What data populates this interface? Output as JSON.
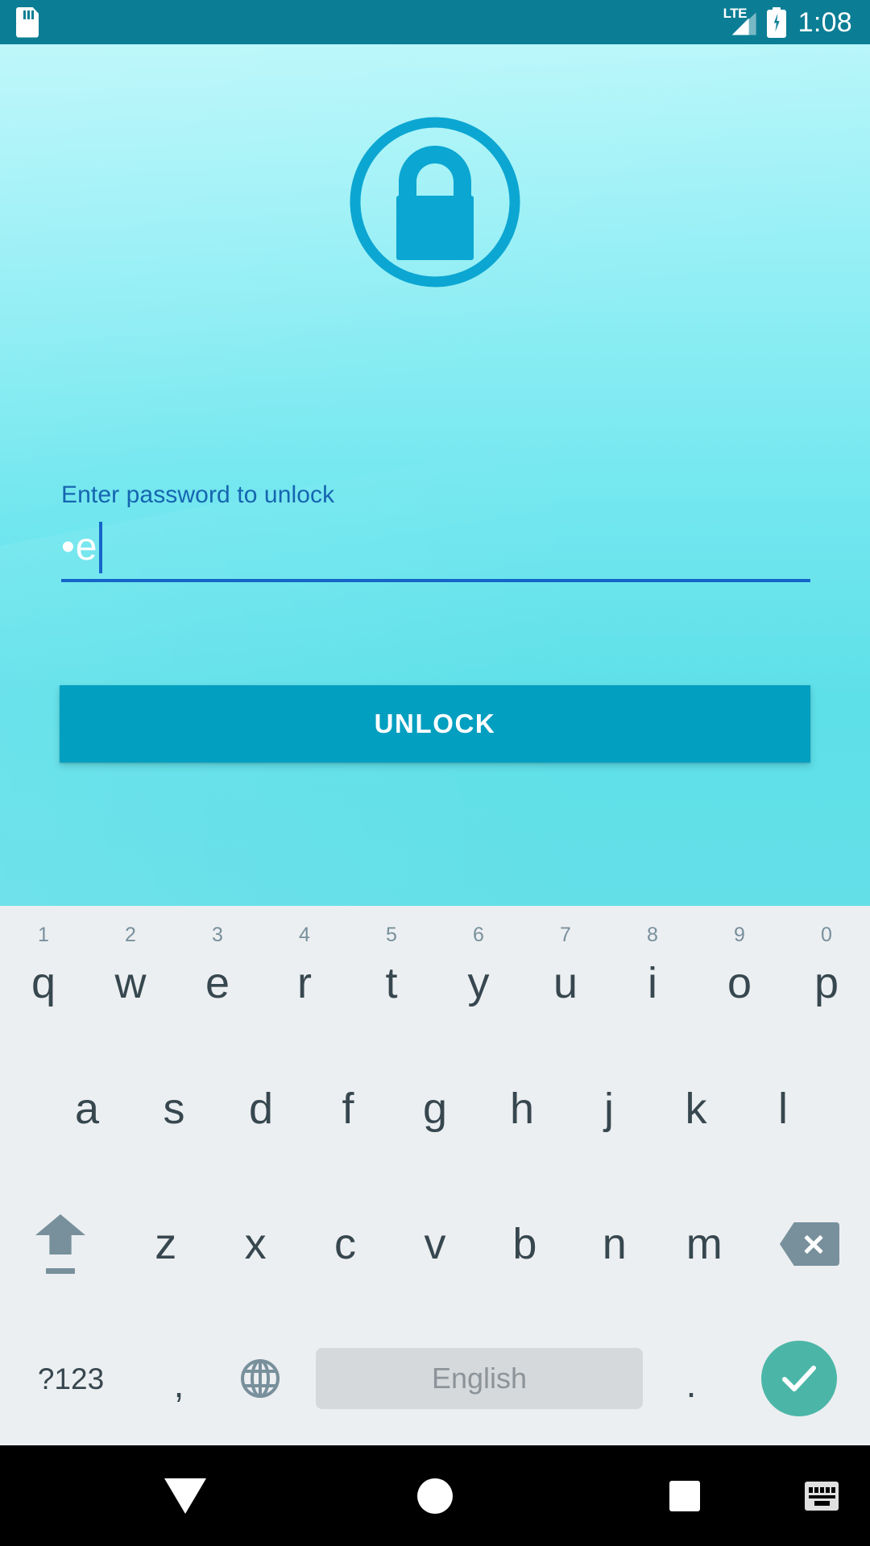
{
  "status_bar": {
    "sd_card_icon": "sd-card-icon",
    "network_label": "LTE",
    "signal_icon": "signal-bars-icon",
    "battery_icon": "battery-charging-icon",
    "time": "1:08",
    "background_color": "#0b7e95"
  },
  "lock_screen": {
    "lock_icon": "lock-circle-icon",
    "accent_color": "#039fc0",
    "label": "Enter password to unlock",
    "label_color": "#1565b0",
    "password_value": "•e",
    "password_placeholder": "",
    "underline_color": "#1565c9",
    "unlock_label": "UNLOCK",
    "wallpaper_top_color": "#b4f6fa",
    "wallpaper_bottom_color": "#63dfe8"
  },
  "keyboard": {
    "background_color": "#eceff1",
    "key_text_color": "#37474f",
    "number_hint_color": "#78909c",
    "row1": [
      {
        "letter": "q",
        "number": "1"
      },
      {
        "letter": "w",
        "number": "2"
      },
      {
        "letter": "e",
        "number": "3"
      },
      {
        "letter": "r",
        "number": "4"
      },
      {
        "letter": "t",
        "number": "5"
      },
      {
        "letter": "y",
        "number": "6"
      },
      {
        "letter": "u",
        "number": "7"
      },
      {
        "letter": "i",
        "number": "8"
      },
      {
        "letter": "o",
        "number": "9"
      },
      {
        "letter": "p",
        "number": "0"
      }
    ],
    "row2": [
      {
        "letter": "a"
      },
      {
        "letter": "s"
      },
      {
        "letter": "d"
      },
      {
        "letter": "f"
      },
      {
        "letter": "g"
      },
      {
        "letter": "h"
      },
      {
        "letter": "j"
      },
      {
        "letter": "k"
      },
      {
        "letter": "l"
      }
    ],
    "row3": [
      {
        "letter": "z"
      },
      {
        "letter": "x"
      },
      {
        "letter": "c"
      },
      {
        "letter": "v"
      },
      {
        "letter": "b"
      },
      {
        "letter": "n"
      },
      {
        "letter": "m"
      }
    ],
    "shift_icon": "shift-arrow-icon",
    "backspace_icon": "backspace-delete-icon",
    "symbols_label": "?123",
    "comma_label": ",",
    "globe_icon": "language-globe-icon",
    "spacebar_label": "English",
    "spacebar_color": "#d5d9dc",
    "period_label": ".",
    "enter_icon": "checkmark-icon",
    "enter_color": "#4bb6a8"
  },
  "nav_bar": {
    "background_color": "#000000",
    "back_icon": "hide-keyboard-down-arrow-icon",
    "home_icon": "home-circle-icon",
    "recents_icon": "recents-square-icon",
    "keyboard_switch_icon": "keyboard-icon"
  }
}
